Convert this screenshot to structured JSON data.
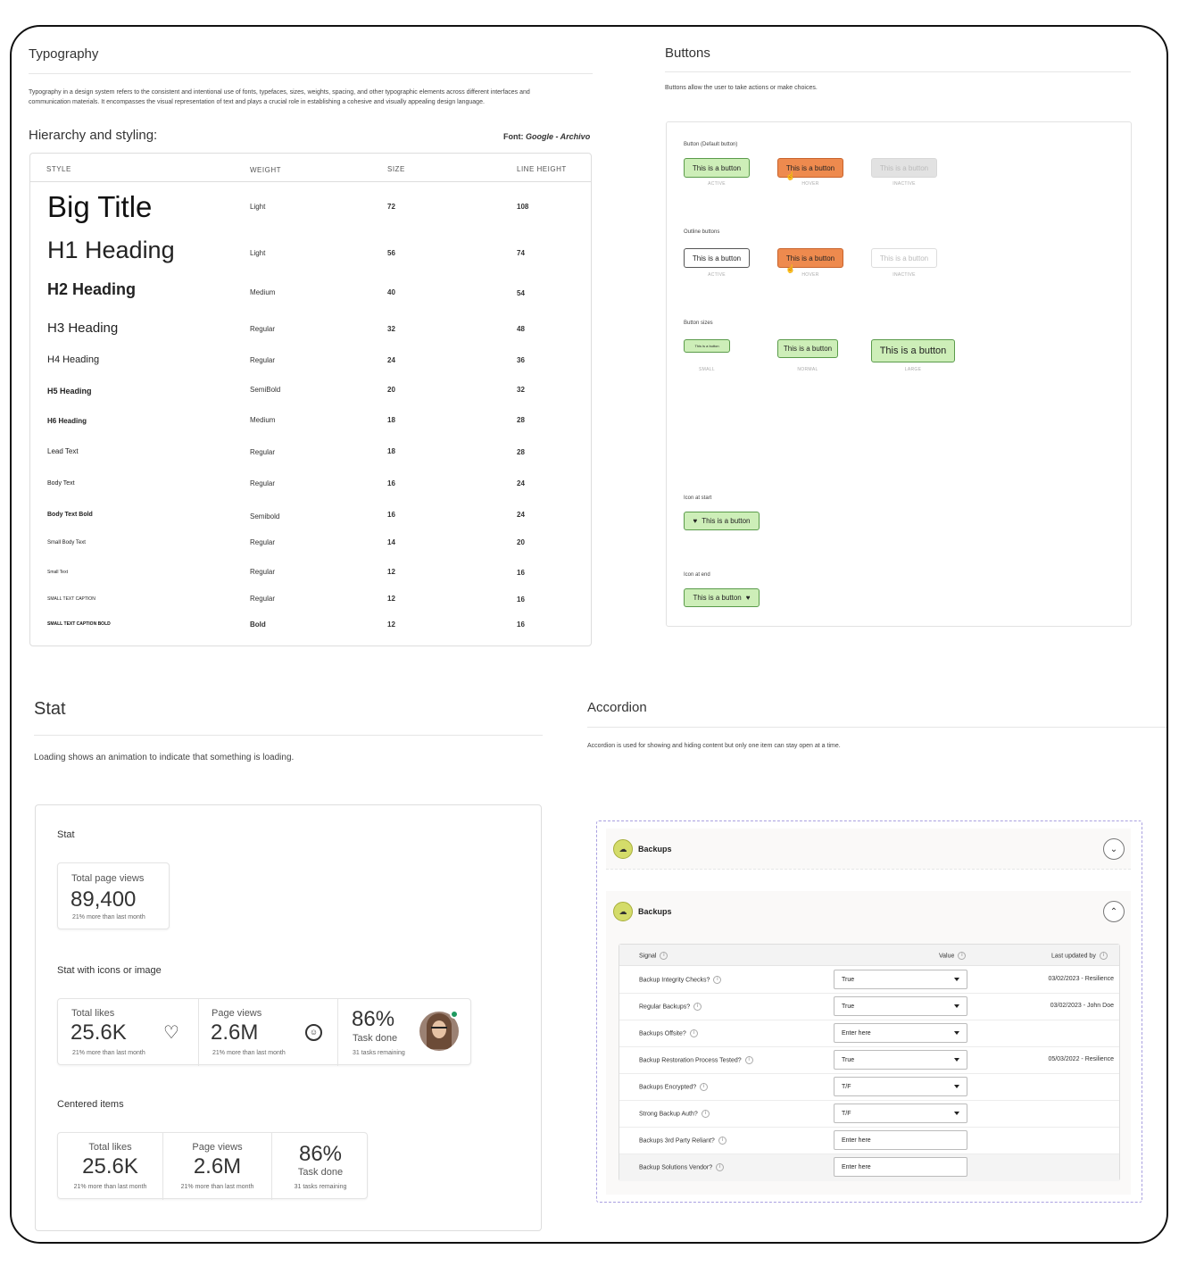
{
  "typography": {
    "title": "Typography",
    "description_1": "Typography in a design system refers to the consistent and intentional use of fonts, typefaces, sizes, weights, spacing, and other typographic elements across different interfaces and",
    "description_2": "communication materials. It encompasses the visual representation of text and plays a crucial role in establishing a cohesive and visually appealing design language.",
    "hierarchy_title": "Hierarchy and styling:",
    "font_label": "Font:",
    "font_value": "Google - Archivo",
    "headers": [
      "STYLE",
      "WEIGHT",
      "SIZE",
      "LINE HEIGHT"
    ],
    "rows": [
      {
        "style": "Big Title",
        "weight": "Light",
        "size": "72",
        "line_height": "108"
      },
      {
        "style": "H1 Heading",
        "weight": "Light",
        "size": "56",
        "line_height": "74"
      },
      {
        "style": "H2 Heading",
        "weight": "Medium",
        "size": "40",
        "line_height": "54"
      },
      {
        "style": "H3 Heading",
        "weight": "Regular",
        "size": "32",
        "line_height": "48"
      },
      {
        "style": "H4 Heading",
        "weight": "Regular",
        "size": "24",
        "line_height": "36"
      },
      {
        "style": "H5 Heading",
        "weight": "SemiBold",
        "size": "20",
        "line_height": "32"
      },
      {
        "style": "H6 Heading",
        "weight": "Medium",
        "size": "18",
        "line_height": "28"
      },
      {
        "style": "Lead Text",
        "weight": "Regular",
        "size": "18",
        "line_height": "28"
      },
      {
        "style": "Body Text",
        "weight": "Regular",
        "size": "16",
        "line_height": "24"
      },
      {
        "style": "Body Text Bold",
        "weight": "Semibold",
        "size": "16",
        "line_height": "24"
      },
      {
        "style": "Small Body Text",
        "weight": "Regular",
        "size": "14",
        "line_height": "20"
      },
      {
        "style": "Small Text",
        "weight": "Regular",
        "size": "12",
        "line_height": "16"
      },
      {
        "style": "SMALL TEXT CAPTION",
        "weight": "Regular",
        "size": "12",
        "line_height": "16"
      },
      {
        "style": "SMALL TEXT CAPTION BOLD",
        "weight": "Bold",
        "size": "12",
        "line_height": "16"
      }
    ]
  },
  "buttons": {
    "title": "Buttons",
    "description": "Buttons allow the user to take actions or make choices.",
    "button_label": "This is a button",
    "default_title": "Button (Default button)",
    "outline_title": "Outline buttons",
    "sizes_title": "Button sizes",
    "icon_start_title": "Icon at start",
    "icon_end_title": "Icon at end",
    "state_active": "ACTIVE",
    "state_hover": "HOVER",
    "state_inactive": "INACTIVE",
    "size_small": "SMALL",
    "size_normal": "NORMAL",
    "size_large": "LARGE",
    "colors": {
      "green": "#cdeeb8",
      "orange": "#ee8a4e",
      "grey": "#e2e2e2"
    }
  },
  "stat": {
    "title": "Stat",
    "description": "Loading shows an animation to indicate that something is loading.",
    "box_title": "Stat",
    "single": {
      "label": "Total page views",
      "value": "89,400",
      "help": "21% more than last month"
    },
    "icons_title": "Stat with icons or image",
    "icons": [
      {
        "label": "Total likes",
        "value": "25.6K",
        "help": "21% more than last month",
        "icon": "heart-outline-icon"
      },
      {
        "label": "Page views",
        "value": "2.6M",
        "help": "21% more than last month",
        "icon": "smile-icon"
      },
      {
        "value": "86%",
        "label": "Task done",
        "help": "31 tasks remaining",
        "icon": "avatar"
      }
    ],
    "centered_title": "Centered items",
    "centered": [
      {
        "label": "Total likes",
        "value": "25.6K",
        "help": "21% more than last month"
      },
      {
        "label": "Page views",
        "value": "2.6M",
        "help": "21% more than last month"
      },
      {
        "value": "86%",
        "label": "Task done",
        "help": "31 tasks remaining"
      }
    ]
  },
  "accordion": {
    "title": "Accordion",
    "description": "Accordion is used for showing and hiding content but only one item can stay open at a time.",
    "item_label": "Backups",
    "table_headers": {
      "signal": "Signal",
      "value": "Value",
      "updated": "Last updated by"
    },
    "rows": [
      {
        "signal": "Backup Integrity Checks?",
        "value": "True",
        "dropdown": true,
        "updated": "03/02/2023 - Resilience"
      },
      {
        "signal": "Regular Backups?",
        "value": "True",
        "dropdown": true,
        "updated": "03/02/2023 - John Doe"
      },
      {
        "signal": "Backups Offsite?",
        "value": "Enter here",
        "dropdown": true,
        "updated": ""
      },
      {
        "signal": "Backup Restoration Process Tested?",
        "value": "True",
        "dropdown": true,
        "updated": "05/03/2022 - Resilience"
      },
      {
        "signal": "Backups Encrypted?",
        "value": "T/F",
        "dropdown": true,
        "updated": ""
      },
      {
        "signal": "Strong Backup Auth?",
        "value": "T/F",
        "dropdown": true,
        "updated": ""
      },
      {
        "signal": "Backups 3rd Party Reliant?",
        "value": "Enter here",
        "dropdown": false,
        "updated": ""
      },
      {
        "signal": "Backup Solutions Vendor?",
        "value": "Enter here",
        "dropdown": false,
        "updated": ""
      }
    ]
  }
}
